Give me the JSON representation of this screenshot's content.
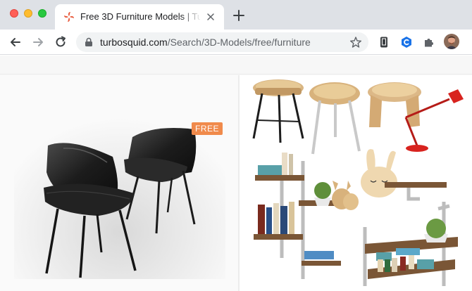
{
  "window": {
    "controls": [
      "close",
      "minimize",
      "zoom"
    ]
  },
  "tab": {
    "title": "Free 3D Furniture Models | Turb",
    "favicon": "turbosquid-favicon"
  },
  "toolbar": {
    "url_host": "turbosquid.com",
    "url_path": "/Search/3D-Models/free/furniture"
  },
  "content": {
    "cards": [
      {
        "badge": "FREE",
        "subject": "two black leather chairs"
      },
      {
        "subject": "wooden stools, red desk lamp, pipe shelves with books, plants and bunny decor"
      }
    ]
  },
  "colors": {
    "tabstrip": "#dee1e6",
    "badge": "#f08a4b",
    "omnibox": "#f1f3f4"
  }
}
